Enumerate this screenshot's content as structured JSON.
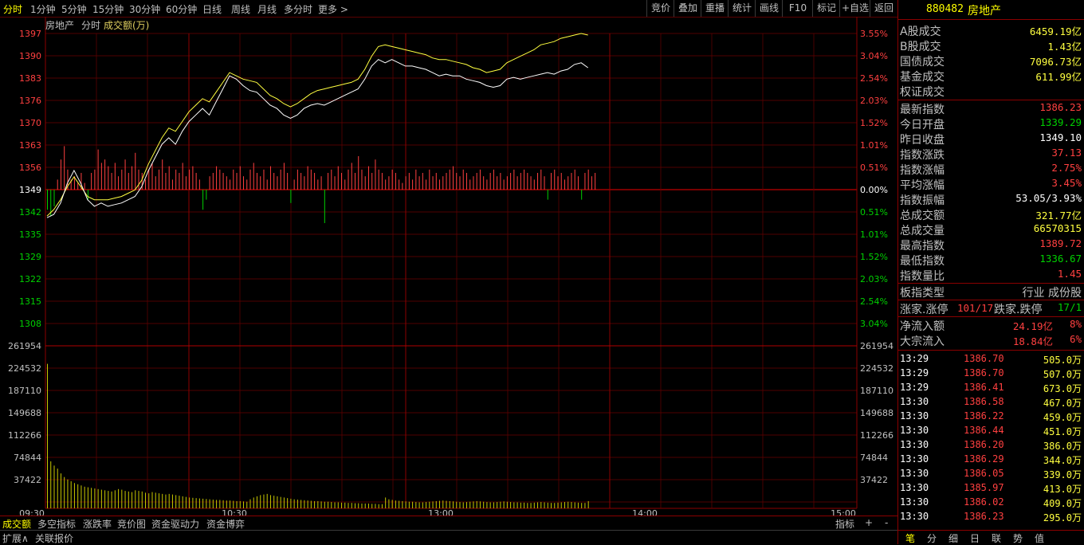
{
  "top_tabs": [
    "分时",
    "1分钟",
    "5分钟",
    "15分钟",
    "30分钟",
    "60分钟",
    "日线",
    "周线",
    "月线",
    "多分时",
    "更多 >"
  ],
  "top_right_buttons": [
    "竞价",
    "叠加",
    "重播",
    "统计",
    "画线",
    "F10",
    "标记",
    "+自选",
    "返回"
  ],
  "chart_header": {
    "name": "房地产",
    "mode": "分时",
    "indicator": "成交额(万)"
  },
  "stock_title": {
    "code": "880482",
    "name": "房地产"
  },
  "colors": {
    "up": "#ff4040",
    "down": "#00d000",
    "grid": "#8b0000",
    "price_line": "#ffffff",
    "avg_line": "#ffff40",
    "volume": "#c8c800",
    "text": "#c0c0c0"
  },
  "turnover_rows": [
    {
      "label": "A股成交",
      "value": "6459.19亿"
    },
    {
      "label": "B股成交",
      "value": "1.43亿"
    },
    {
      "label": "国债成交",
      "value": "7096.73亿"
    },
    {
      "label": "基金成交",
      "value": "611.99亿"
    },
    {
      "label": "权证成交",
      "value": ""
    }
  ],
  "index_rows": [
    {
      "label": "最新指数",
      "value": "1386.23",
      "color": "up"
    },
    {
      "label": "今日开盘",
      "value": "1339.29",
      "color": "down"
    },
    {
      "label": "昨日收盘",
      "value": "1349.10",
      "color": "white"
    },
    {
      "label": "指数涨跌",
      "value": "37.13",
      "color": "up"
    },
    {
      "label": "指数涨幅",
      "value": "2.75%",
      "color": "up"
    },
    {
      "label": "平均涨幅",
      "value": "3.45%",
      "color": "up"
    },
    {
      "label": "指数振幅",
      "value": "53.05/3.93%",
      "color": "white"
    },
    {
      "label": "总成交额",
      "value": "321.77亿",
      "color": "yellow"
    },
    {
      "label": "总成交量",
      "value": "66570315",
      "color": "yellow"
    },
    {
      "label": "最高指数",
      "value": "1389.72",
      "color": "up"
    },
    {
      "label": "最低指数",
      "value": "1336.67",
      "color": "down"
    },
    {
      "label": "指数量比",
      "value": "1.45",
      "color": "up"
    }
  ],
  "sector": {
    "label": "板指类型",
    "value": "行业 成份股"
  },
  "breadth": {
    "up_label": "涨家.涨停",
    "up_value": "101/17",
    "down_label": "跌家.跌停",
    "down_value": "17/1"
  },
  "flows": [
    {
      "label": "净流入额",
      "value": "24.19亿",
      "pct": "8%"
    },
    {
      "label": "大宗流入",
      "value": "18.84亿",
      "pct": "6%"
    }
  ],
  "ticks": [
    {
      "time": "13:29",
      "price": "1386.70",
      "vol": "505.0万"
    },
    {
      "time": "13:29",
      "price": "1386.70",
      "vol": "507.0万"
    },
    {
      "time": "13:29",
      "price": "1386.41",
      "vol": "673.0万"
    },
    {
      "time": "13:30",
      "price": "1386.58",
      "vol": "467.0万"
    },
    {
      "time": "13:30",
      "price": "1386.22",
      "vol": "459.0万"
    },
    {
      "time": "13:30",
      "price": "1386.44",
      "vol": "451.0万"
    },
    {
      "time": "13:30",
      "price": "1386.20",
      "vol": "386.0万"
    },
    {
      "time": "13:30",
      "price": "1386.29",
      "vol": "344.0万"
    },
    {
      "time": "13:30",
      "price": "1386.05",
      "vol": "339.0万"
    },
    {
      "time": "13:30",
      "price": "1385.97",
      "vol": "413.0万"
    },
    {
      "time": "13:30",
      "price": "1386.02",
      "vol": "409.0万"
    },
    {
      "time": "13:30",
      "price": "1386.23",
      "vol": "295.0万"
    }
  ],
  "chart_data": {
    "type": "line",
    "price_axis_left": [
      "1397",
      "1390",
      "1383",
      "1376",
      "1370",
      "1363",
      "1356",
      "1349",
      "1342",
      "1335",
      "1329",
      "1322",
      "1315",
      "1308"
    ],
    "pct_axis_right": [
      "3.55%",
      "3.04%",
      "2.54%",
      "2.03%",
      "1.52%",
      "1.01%",
      "0.51%",
      "0.00%",
      "0.51%",
      "1.01%",
      "1.52%",
      "2.03%",
      "2.54%",
      "3.04%"
    ],
    "volume_axis_left": [
      "261954",
      "224532",
      "187110",
      "149688",
      "112266",
      "74844",
      "37422"
    ],
    "volume_axis_right": [
      "261954",
      "224532",
      "187110",
      "149688",
      "112266",
      "74844",
      "37422"
    ],
    "time_labels": [
      "09:30",
      "10:30",
      "13:00",
      "14:00",
      "15:00"
    ],
    "prev_close": 1349.1,
    "ylim": [
      1304.5,
      1401
    ],
    "vol_max": 261954,
    "price_series": [
      [
        0,
        1340.5
      ],
      [
        2,
        1341.5
      ],
      [
        4,
        1345
      ],
      [
        6,
        1351
      ],
      [
        8,
        1355
      ],
      [
        10,
        1351
      ],
      [
        12,
        1346
      ],
      [
        14,
        1344
      ],
      [
        16,
        1345
      ],
      [
        18,
        1344
      ],
      [
        20,
        1344.5
      ],
      [
        22,
        1345
      ],
      [
        24,
        1346
      ],
      [
        26,
        1347
      ],
      [
        28,
        1350
      ],
      [
        30,
        1355
      ],
      [
        32,
        1359
      ],
      [
        34,
        1363
      ],
      [
        36,
        1365
      ],
      [
        38,
        1363
      ],
      [
        40,
        1367
      ],
      [
        42,
        1370
      ],
      [
        44,
        1372
      ],
      [
        46,
        1374
      ],
      [
        48,
        1372
      ],
      [
        50,
        1376
      ],
      [
        52,
        1380
      ],
      [
        54,
        1384
      ],
      [
        56,
        1383
      ],
      [
        58,
        1381
      ],
      [
        60,
        1379.5
      ],
      [
        62,
        1379
      ],
      [
        64,
        1377
      ],
      [
        66,
        1375
      ],
      [
        68,
        1374
      ],
      [
        70,
        1372
      ],
      [
        72,
        1371
      ],
      [
        74,
        1372
      ],
      [
        76,
        1374
      ],
      [
        78,
        1375
      ],
      [
        80,
        1375.5
      ],
      [
        82,
        1375
      ],
      [
        84,
        1376
      ],
      [
        86,
        1377
      ],
      [
        88,
        1378
      ],
      [
        90,
        1379
      ],
      [
        92,
        1380
      ],
      [
        94,
        1383
      ],
      [
        96,
        1387
      ],
      [
        98,
        1389
      ],
      [
        100,
        1388
      ],
      [
        102,
        1389
      ],
      [
        104,
        1388
      ],
      [
        106,
        1387
      ],
      [
        108,
        1387
      ],
      [
        110,
        1386.5
      ],
      [
        112,
        1386
      ],
      [
        114,
        1385
      ],
      [
        116,
        1384
      ],
      [
        118,
        1384.5
      ],
      [
        120,
        1384
      ],
      [
        122,
        1384
      ],
      [
        124,
        1383
      ],
      [
        126,
        1382.5
      ],
      [
        128,
        1382
      ],
      [
        130,
        1381
      ],
      [
        132,
        1380.5
      ],
      [
        134,
        1381
      ],
      [
        136,
        1383
      ],
      [
        138,
        1383.5
      ],
      [
        140,
        1383
      ],
      [
        142,
        1383.5
      ],
      [
        144,
        1384
      ],
      [
        146,
        1384.5
      ],
      [
        148,
        1385
      ],
      [
        150,
        1384.5
      ],
      [
        152,
        1385.5
      ],
      [
        154,
        1386
      ],
      [
        156,
        1387.5
      ],
      [
        158,
        1388
      ],
      [
        160,
        1386.5
      ]
    ],
    "avg_series": [
      [
        0,
        1341
      ],
      [
        2,
        1343
      ],
      [
        4,
        1346
      ],
      [
        6,
        1350
      ],
      [
        8,
        1353
      ],
      [
        10,
        1350
      ],
      [
        12,
        1347
      ],
      [
        14,
        1346
      ],
      [
        16,
        1346
      ],
      [
        18,
        1346
      ],
      [
        20,
        1346.5
      ],
      [
        22,
        1347
      ],
      [
        24,
        1348
      ],
      [
        26,
        1349
      ],
      [
        28,
        1352
      ],
      [
        30,
        1357
      ],
      [
        32,
        1361
      ],
      [
        34,
        1365
      ],
      [
        36,
        1368
      ],
      [
        38,
        1367
      ],
      [
        40,
        1370
      ],
      [
        42,
        1373
      ],
      [
        44,
        1375
      ],
      [
        46,
        1377
      ],
      [
        48,
        1376
      ],
      [
        50,
        1379
      ],
      [
        52,
        1382
      ],
      [
        54,
        1385
      ],
      [
        56,
        1384
      ],
      [
        58,
        1383
      ],
      [
        60,
        1382.5
      ],
      [
        62,
        1382
      ],
      [
        64,
        1380
      ],
      [
        66,
        1378
      ],
      [
        68,
        1377
      ],
      [
        70,
        1375.5
      ],
      [
        72,
        1374.5
      ],
      [
        74,
        1375.5
      ],
      [
        76,
        1377
      ],
      [
        78,
        1378.5
      ],
      [
        80,
        1379.5
      ],
      [
        82,
        1380
      ],
      [
        84,
        1380.5
      ],
      [
        86,
        1381
      ],
      [
        88,
        1381.5
      ],
      [
        90,
        1382
      ],
      [
        92,
        1383
      ],
      [
        94,
        1386
      ],
      [
        96,
        1390
      ],
      [
        98,
        1393
      ],
      [
        100,
        1393.5
      ],
      [
        102,
        1393
      ],
      [
        104,
        1392.5
      ],
      [
        106,
        1392
      ],
      [
        108,
        1391.5
      ],
      [
        110,
        1391
      ],
      [
        112,
        1390.5
      ],
      [
        114,
        1389.5
      ],
      [
        116,
        1389
      ],
      [
        118,
        1389
      ],
      [
        120,
        1388.5
      ],
      [
        122,
        1388
      ],
      [
        124,
        1387.5
      ],
      [
        126,
        1386.5
      ],
      [
        128,
        1386
      ],
      [
        130,
        1385
      ],
      [
        132,
        1385.5
      ],
      [
        134,
        1386
      ],
      [
        136,
        1388
      ],
      [
        138,
        1389
      ],
      [
        140,
        1390
      ],
      [
        142,
        1391
      ],
      [
        144,
        1392
      ],
      [
        146,
        1393.5
      ],
      [
        148,
        1394
      ],
      [
        150,
        1394.5
      ],
      [
        152,
        1395.5
      ],
      [
        154,
        1396
      ],
      [
        156,
        1396.5
      ],
      [
        158,
        1397
      ],
      [
        160,
        1396.5
      ]
    ],
    "volume_series": [
      240000,
      78000,
      71000,
      66000,
      58000,
      52000,
      48000,
      45000,
      42000,
      40000,
      38000,
      36000,
      35000,
      34000,
      33000,
      32000,
      31000,
      30000,
      29000,
      28000,
      30000,
      32000,
      31000,
      29000,
      28000,
      27000,
      30000,
      29000,
      28000,
      26000,
      25000,
      27000,
      26000,
      25000,
      24000,
      23000,
      24000,
      23000,
      22000,
      21000,
      20000,
      19000,
      18000,
      17500,
      17000,
      16500,
      16000,
      15500,
      15000,
      14500,
      14000,
      14000,
      13500,
      13000,
      13000,
      12500,
      12000,
      12000,
      11500,
      11000,
      15000,
      18000,
      20000,
      22000,
      23000,
      24000,
      22000,
      21000,
      20000,
      19000,
      18000,
      17000,
      16000,
      15000,
      14500,
      14000,
      13500,
      13000,
      12500,
      12000,
      12000,
      11500,
      11000,
      11000,
      10500,
      10000,
      10000,
      9500,
      9500,
      9000,
      9000,
      8500,
      8500,
      8000,
      8000,
      8000,
      7500,
      7500,
      7000,
      7000,
      18000,
      15000,
      14000,
      13000,
      12500,
      12000,
      11500,
      11000,
      11000,
      10500,
      10000,
      10000,
      10500,
      11000,
      11500,
      12000,
      12500,
      13000,
      12500,
      12000,
      11500,
      11000,
      10500,
      10000,
      10500,
      11000,
      11500,
      12000,
      11500,
      11000,
      10500,
      10000,
      10000,
      10500,
      11000,
      11500,
      11000,
      10500,
      10000,
      10000,
      9500,
      9500,
      9000,
      9000,
      9500,
      10000,
      10500,
      10000,
      9500,
      9000,
      9000,
      9500,
      10000,
      10500,
      11000,
      10500,
      10000,
      9500,
      9000,
      9000,
      12000
    ],
    "breadth_bars": [
      -0.6,
      -0.8,
      -0.5,
      0.3,
      0.9,
      1.3,
      0.6,
      0.3,
      0.4,
      0.2,
      0.5,
      0.2,
      -0.3,
      0.5,
      0.6,
      1.2,
      0.8,
      0.9,
      0.7,
      0.5,
      0.8,
      0.4,
      0.6,
      0.9,
      0.5,
      0.7,
      1.1,
      0.6,
      0.5,
      0.3,
      0.6,
      0.8,
      0.4,
      0.6,
      0.9,
      0.5,
      0.7,
      0.3,
      0.6,
      0.5,
      0.8,
      0.4,
      0.6,
      0.7,
      0.5,
      0.3,
      -0.6,
      -0.3,
      0.4,
      0.5,
      0.7,
      0.6,
      0.5,
      0.4,
      0.3,
      0.6,
      0.5,
      0.7,
      0.4,
      0.3,
      0.6,
      0.8,
      0.5,
      0.4,
      0.6,
      0.3,
      0.7,
      0.5,
      0.4,
      0.6,
      0.8,
      0.5,
      -0.4,
      0.3,
      0.6,
      0.5,
      0.4,
      0.7,
      0.6,
      0.5,
      0.3,
      0.4,
      -1.0,
      0.5,
      0.6,
      0.4,
      0.7,
      0.5,
      0.3,
      0.6,
      0.8,
      0.5,
      1.0,
      0.6,
      0.4,
      0.7,
      0.5,
      0.9,
      0.6,
      0.5,
      0.3,
      0.4,
      0.6,
      0.5,
      0.3,
      0.2,
      0.4,
      0.5,
      0.3,
      0.6,
      0.4,
      0.5,
      0.3,
      0.6,
      0.4,
      0.5,
      0.3,
      0.4,
      0.5,
      0.6,
      0.7,
      0.5,
      0.4,
      0.6,
      0.5,
      0.3,
      0.4,
      0.5,
      0.6,
      0.4,
      0.3,
      0.5,
      0.6,
      0.4,
      0.5,
      0.3,
      0.4,
      0.5,
      0.6,
      0.4,
      0.5,
      0.6,
      0.5,
      0.4,
      0.3,
      0.5,
      0.6,
      0.4,
      -0.3,
      0.5,
      0.6,
      0.4,
      0.5,
      0.3,
      0.4,
      0.5,
      0.6,
      0.4,
      -0.3,
      0.5,
      0.6,
      0.4,
      0.5
    ]
  },
  "bottom_tabs": [
    "成交额",
    "多空指标",
    "涨跌率",
    "竞价图",
    "资金驱动力",
    "资金博弈"
  ],
  "bottom_right": [
    "指标",
    "+",
    "-"
  ],
  "status_tabs": [
    "扩展∧",
    "关联报价"
  ],
  "right_tabs": [
    "笔",
    "分",
    "细",
    "日",
    "联",
    "势",
    "值"
  ]
}
